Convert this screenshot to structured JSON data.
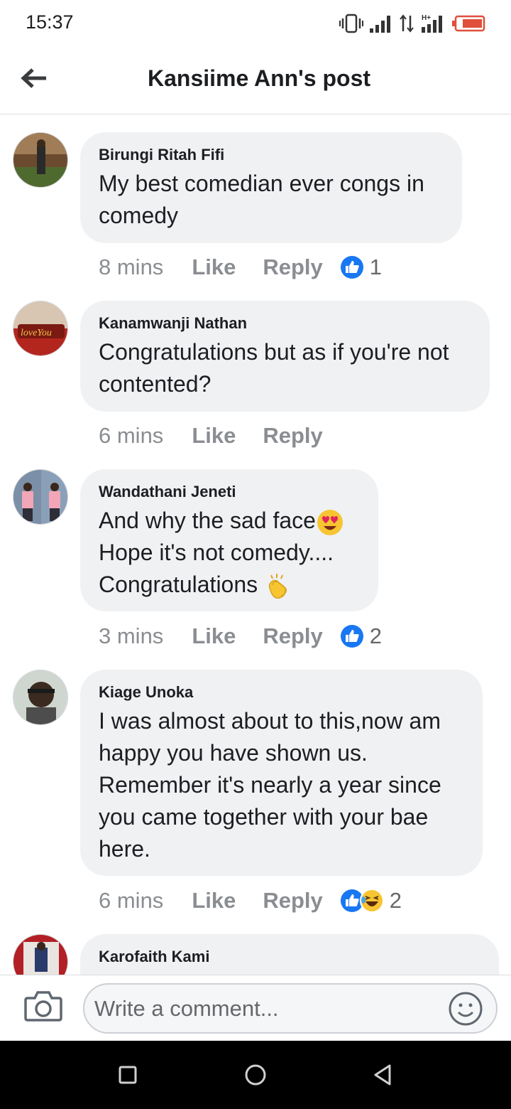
{
  "status_bar": {
    "time": "15:37",
    "icons": [
      "vibrate-icon",
      "signal-icon",
      "data-arrows-icon",
      "hplus-signal-icon",
      "battery-low-icon"
    ]
  },
  "header": {
    "title": "Kansiime Ann's post",
    "back_icon": "arrow-left-icon"
  },
  "comments": [
    {
      "author": "Birungi Ritah Fifi",
      "lines": [
        "My best comedian ever congs in",
        "comedy"
      ],
      "time": "8 mins",
      "like_label": "Like",
      "reply_label": "Reply",
      "reactions": [
        "like"
      ],
      "reaction_count": "1"
    },
    {
      "author": "Kanamwanji Nathan",
      "lines": [
        "Congratulations but as if you're not",
        "contented?"
      ],
      "time": "6 mins",
      "like_label": "Like",
      "reply_label": "Reply",
      "reactions": [],
      "reaction_count": ""
    },
    {
      "author": "Wandathani Jeneti",
      "lines": [
        "And why the sad face",
        "Hope it's not comedy....",
        "Congratulations"
      ],
      "time": "3 mins",
      "like_label": "Like",
      "reply_label": "Reply",
      "reactions": [
        "like"
      ],
      "reaction_count": "2"
    },
    {
      "author": "Kiage Unoka",
      "lines": [
        "I was almost about to this,now am",
        "happy you have shown us.",
        "Remember it's nearly a year since",
        "you came together with your bae",
        "here."
      ],
      "time": "6 mins",
      "like_label": "Like",
      "reply_label": "Reply",
      "reactions": [
        "like",
        "haha"
      ],
      "reaction_count": "2"
    },
    {
      "author": "Karofaith Kami",
      "lines": [],
      "time": "",
      "like_label": "",
      "reply_label": "",
      "reactions": [],
      "reaction_count": ""
    }
  ],
  "input_bar": {
    "placeholder": "Write a comment...",
    "camera_icon": "camera-icon",
    "emoji_icon": "smiley-icon"
  },
  "nav_bar": {
    "icons": [
      "square-recents-icon",
      "circle-home-icon",
      "triangle-back-icon"
    ]
  },
  "colors": {
    "bubble": "#eff1f3",
    "meta_text": "#8a8d91",
    "like_blue": "#1877f2",
    "battery_red": "#e04f3a"
  }
}
